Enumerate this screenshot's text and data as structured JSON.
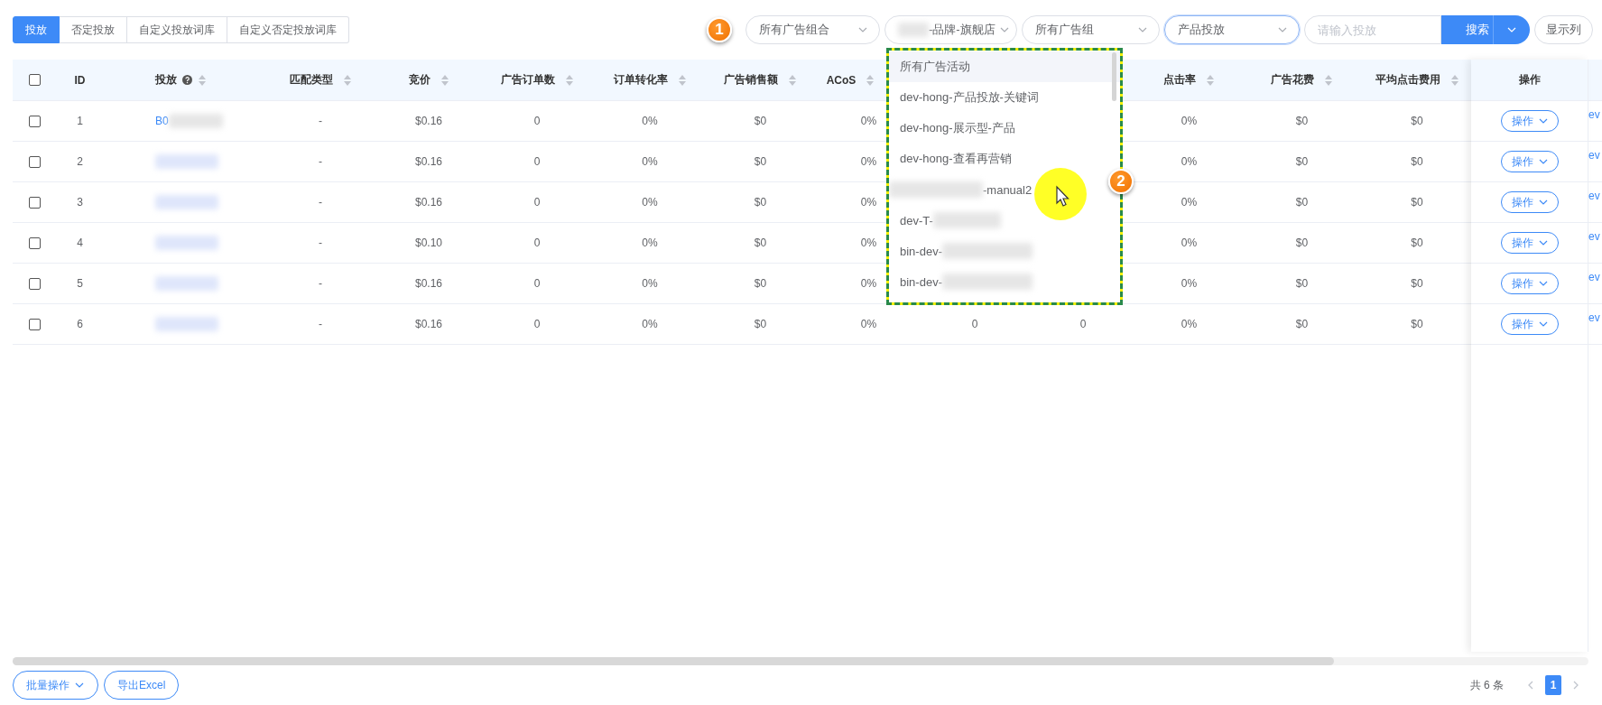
{
  "tabs": [
    {
      "label": "投放",
      "selected": true
    },
    {
      "label": "否定投放",
      "selected": false
    },
    {
      "label": "自定义投放词库",
      "selected": false
    },
    {
      "label": "自定义否定投放词库",
      "selected": false
    }
  ],
  "filters": {
    "step_badge": "1",
    "selects": [
      {
        "value": "所有广告组合",
        "focused": false
      },
      {
        "value": "-品牌-旗舰店",
        "redacted_before": true,
        "focused": false
      },
      {
        "value": "所有广告组",
        "focused": false
      },
      {
        "value": "产品投放",
        "focused": true
      }
    ],
    "search_input": {
      "placeholder": "请输入投放"
    },
    "search_button": "搜索",
    "columns_button": "显示列"
  },
  "dropdown": {
    "step_badge": "2",
    "items": [
      {
        "text": "所有广告活动",
        "hovered": true
      },
      {
        "text": "dev-hong-产品投放-关键词",
        "hovered": false
      },
      {
        "text": "dev-hong-展示型-产品",
        "hovered": false
      },
      {
        "text": "dev-hong-查看再营销",
        "hovered": false
      },
      {
        "text": "-manual2",
        "redacted_before": true,
        "hovered": false
      },
      {
        "text": "dev-T-",
        "redacted_after": true,
        "hovered": false
      },
      {
        "text": "bin-dev-",
        "redacted_after": true,
        "hovered": false
      },
      {
        "text": "bin-dev-",
        "redacted_after": true,
        "hovered": false
      }
    ]
  },
  "table": {
    "select_all_checked": false,
    "columns": [
      {
        "label": "ID",
        "sortable": false
      },
      {
        "label": "投放",
        "sortable": true,
        "help": true
      },
      {
        "label": "匹配类型",
        "sortable": true
      },
      {
        "label": "竞价",
        "sortable": true
      },
      {
        "label": "广告订单数",
        "sortable": true
      },
      {
        "label": "订单转化率",
        "sortable": true
      },
      {
        "label": "广告销售额",
        "sortable": true
      },
      {
        "label": "ACoS",
        "sortable": true
      },
      null,
      null,
      {
        "label": "点击率",
        "sortable": true
      },
      {
        "label": "广告花费",
        "sortable": true
      },
      {
        "label": "平均点击费用",
        "sortable": true
      }
    ],
    "action_column": "操作",
    "rows": [
      {
        "checked": false,
        "cells": [
          "1",
          "B0",
          "-",
          "$0.16",
          "0",
          "0%",
          "$0",
          "0%",
          null,
          null,
          "0%",
          "$0",
          "$0"
        ],
        "action": "操作",
        "overflow": "ev"
      },
      {
        "checked": false,
        "cells": [
          "2",
          null,
          "-",
          "$0.16",
          "0",
          "0%",
          "$0",
          "0%",
          null,
          null,
          "0%",
          "$0",
          "$0"
        ],
        "action": "操作",
        "overflow": "ev"
      },
      {
        "checked": false,
        "cells": [
          "3",
          null,
          "-",
          "$0.16",
          "0",
          "0%",
          "$0",
          "0%",
          null,
          null,
          "0%",
          "$0",
          "$0"
        ],
        "action": "操作",
        "overflow": "ev"
      },
      {
        "checked": false,
        "cells": [
          "4",
          null,
          "-",
          "$0.10",
          "0",
          "0%",
          "$0",
          "0%",
          null,
          null,
          "0%",
          "$0",
          "$0"
        ],
        "action": "操作",
        "overflow": "ev"
      },
      {
        "checked": false,
        "cells": [
          "5",
          null,
          "-",
          "$0.16",
          "0",
          "0%",
          "$0",
          "0%",
          null,
          null,
          "0%",
          "$0",
          "$0"
        ],
        "action": "操作",
        "overflow": "ev"
      },
      {
        "checked": false,
        "cells": [
          "6",
          null,
          "-",
          "$0.16",
          "0",
          "0%",
          "$0",
          "0%",
          "0",
          "0",
          "0%",
          "$0",
          "$0"
        ],
        "action": "操作",
        "overflow": "ev"
      }
    ]
  },
  "footer": {
    "batch_button": "批量操作",
    "export_button": "导出Excel",
    "total": "共 6 条",
    "pages": [
      {
        "label": "1",
        "selected": true
      }
    ]
  }
}
